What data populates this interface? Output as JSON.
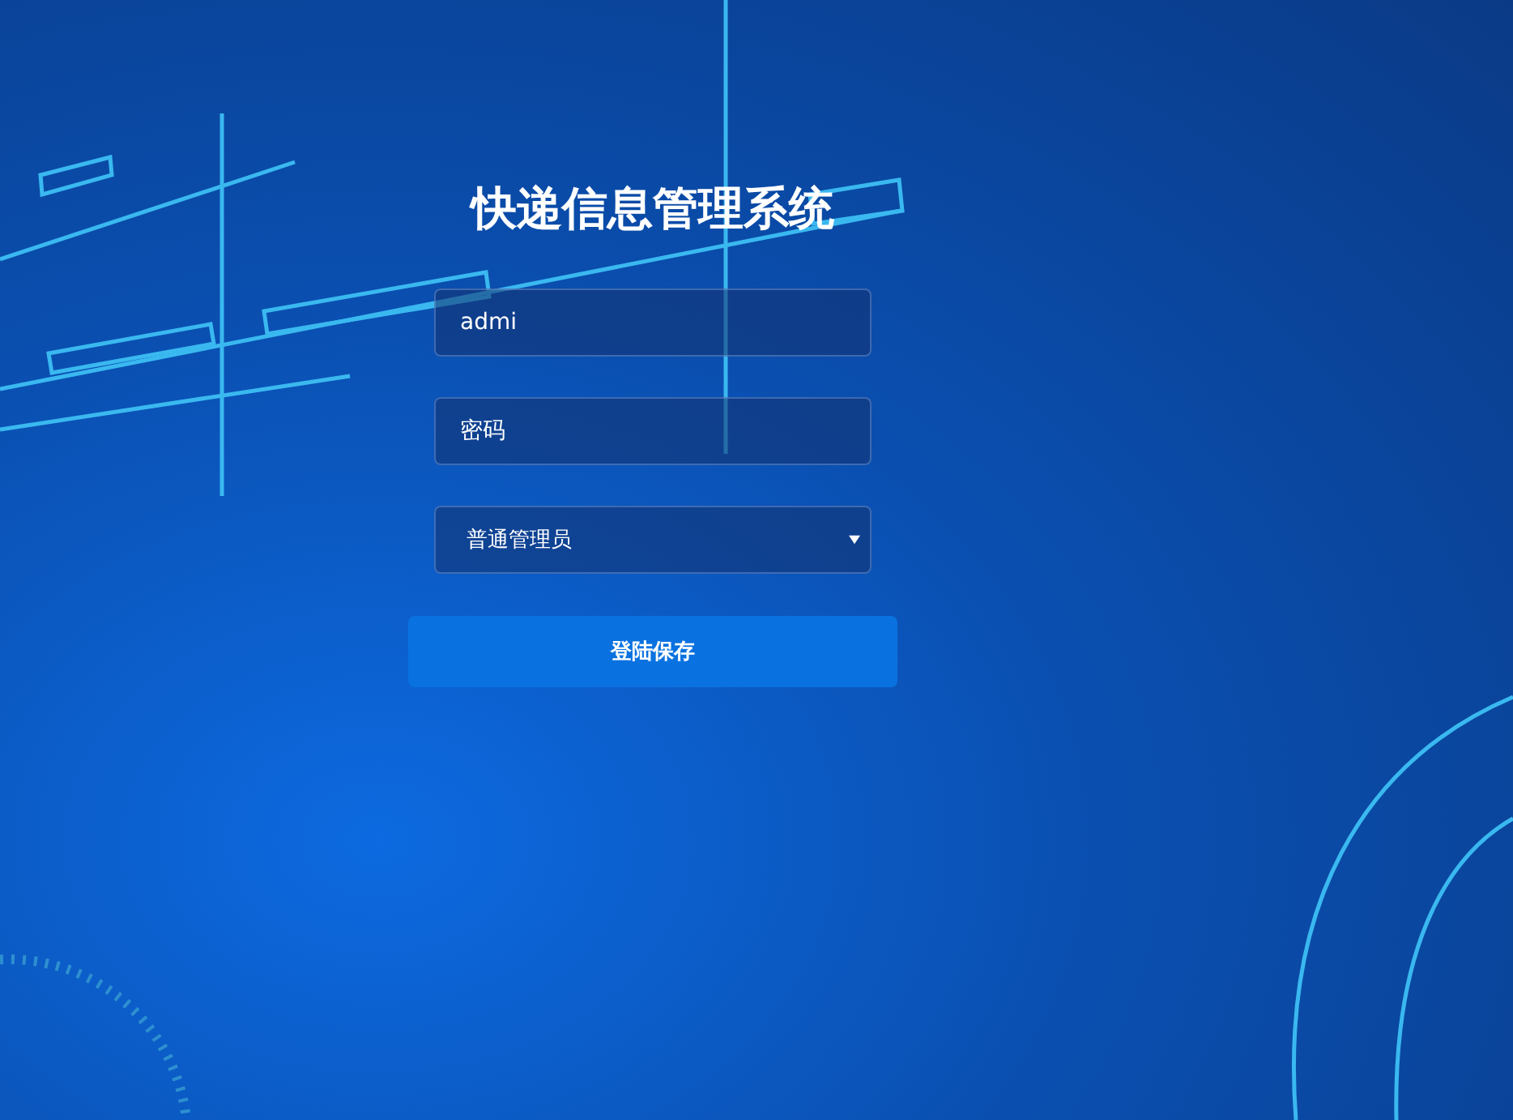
{
  "title": "快递信息管理系统",
  "username": {
    "value": "admi"
  },
  "password": {
    "placeholder": "密码"
  },
  "role": {
    "value": "普通管理员"
  },
  "submit": {
    "label": "登陆保存"
  }
}
